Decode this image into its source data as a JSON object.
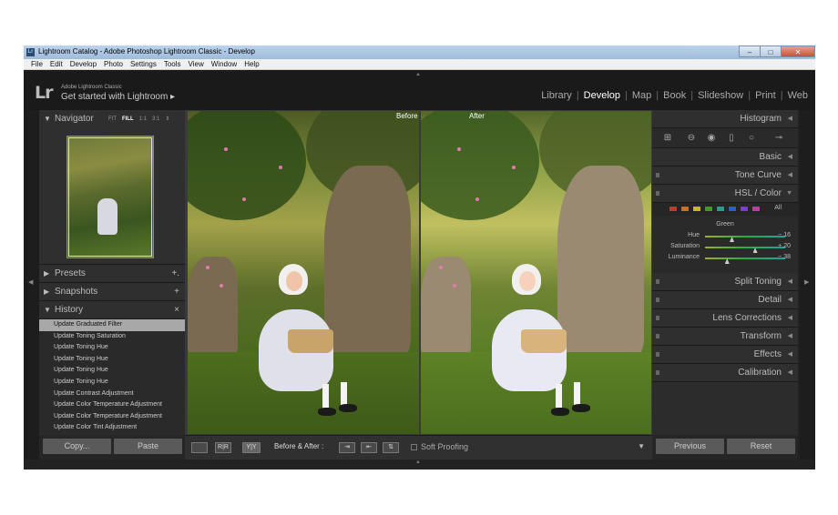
{
  "window": {
    "title": "Lightroom Catalog - Adobe Photoshop Lightroom Classic - Develop",
    "controls": [
      "–",
      "□",
      "✕"
    ]
  },
  "menu": [
    "File",
    "Edit",
    "Develop",
    "Photo",
    "Settings",
    "Tools",
    "View",
    "Window",
    "Help"
  ],
  "identity": {
    "logo": "Lr",
    "product": "Adobe Lightroom Classic",
    "tagline": "Get started with Lightroom ▸"
  },
  "modules": [
    "Library",
    "Develop",
    "Map",
    "Book",
    "Slideshow",
    "Print",
    "Web"
  ],
  "active_module": "Develop",
  "left_panel": {
    "navigator": {
      "label": "Navigator",
      "zoom": [
        "FIT",
        "FILL",
        "1:1",
        "3:1"
      ],
      "zoom_active": "FILL",
      "zoom_arrows": "⇕"
    },
    "presets": {
      "label": "Presets",
      "action": "+."
    },
    "snapshots": {
      "label": "Snapshots",
      "action": "+"
    },
    "history": {
      "label": "History",
      "action": "×",
      "items": [
        "Update Graduated Filter",
        "Update Toning Saturation",
        "Update Toning Hue",
        "Update Toning Hue",
        "Update Toning Hue",
        "Update Toning Hue",
        "Update Contrast Adjustment",
        "Update Color Temperature Adjustment",
        "Update Color Temperature Adjustment",
        "Update Color Tint Adjustment"
      ],
      "selected_index": 0
    },
    "buttons": {
      "copy": "Copy...",
      "paste": "Paste"
    }
  },
  "viewer": {
    "before_label": "Before",
    "after_label": "After"
  },
  "toolbar": {
    "view_loupe": "",
    "view_rr": "R|R",
    "view_yy": "Y|Y",
    "before_after_label": "Before & After :",
    "swap_settings": "⇥",
    "copy_settings": "⇤",
    "swap_views": "⇅",
    "soft_proofing": "Soft Proofing",
    "menu_arrow": "▼"
  },
  "right_panel": {
    "histogram": "Histogram",
    "basic": "Basic",
    "tone_curve": "Tone Curve",
    "hsl_color": "HSL / Color",
    "hsl_all": "All",
    "hsl_swatches": [
      "#c23a2a",
      "#c8702a",
      "#c9b62a",
      "#3e9a2e",
      "#2a9a8a",
      "#2a5ec8",
      "#7a3ec8",
      "#c23aa0"
    ],
    "hsl_group": "Green",
    "hsl_rows": [
      {
        "label": "Hue",
        "value": "− 16",
        "position": 0.33
      },
      {
        "label": "Saturation",
        "value": "+ 20",
        "position": 0.62
      },
      {
        "label": "Luminance",
        "value": "− 38",
        "position": 0.27
      }
    ],
    "split_toning": "Split Toning",
    "detail": "Detail",
    "lens_corrections": "Lens Corrections",
    "transform": "Transform",
    "effects": "Effects",
    "calibration": "Calibration",
    "buttons": {
      "previous": "Previous",
      "reset": "Reset"
    }
  }
}
